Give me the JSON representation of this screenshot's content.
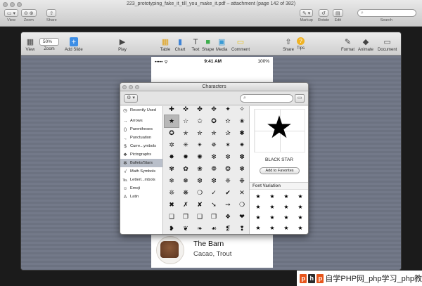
{
  "preview": {
    "title": "223_prototyping_fake_it_till_you_make_it.pdf – attachment (page 142 of 382)",
    "toolbar": [
      {
        "name": "view",
        "glyph": "▭ ▾",
        "label": "View"
      },
      {
        "name": "zoom",
        "glyph": "⊖ ⊕",
        "label": "Zoom"
      },
      {
        "name": "share",
        "glyph": "⇧",
        "label": "Share"
      },
      {
        "name": "markup",
        "glyph": "✎ ▾",
        "label": "Markup"
      },
      {
        "name": "rotate",
        "glyph": "↺",
        "label": "Rotate"
      },
      {
        "name": "edit",
        "glyph": "▤",
        "label": "Edit"
      }
    ],
    "search_label": "Search"
  },
  "keynote": {
    "zoom_value": "50%",
    "tools": [
      {
        "name": "view",
        "glyph": "▦",
        "label": "View"
      },
      {
        "name": "zoom",
        "glyph": "",
        "label": "Zoom"
      },
      {
        "name": "add-slide",
        "glyph": "+",
        "label": "Add Slide"
      },
      {
        "name": "play",
        "glyph": "▶",
        "label": "Play"
      },
      {
        "name": "table",
        "glyph": "▦",
        "label": "Table"
      },
      {
        "name": "chart",
        "glyph": "▮",
        "label": "Chart"
      },
      {
        "name": "text",
        "glyph": "T",
        "label": "Text"
      },
      {
        "name": "shape",
        "glyph": "■",
        "label": "Shape"
      },
      {
        "name": "media",
        "glyph": "▣",
        "label": "Media"
      },
      {
        "name": "comment",
        "glyph": "▭",
        "label": "Comment"
      },
      {
        "name": "share",
        "glyph": "⇧",
        "label": "Share"
      },
      {
        "name": "tips",
        "glyph": "?",
        "label": "Tips"
      },
      {
        "name": "format",
        "glyph": "✎",
        "label": "Format"
      },
      {
        "name": "animate",
        "glyph": "◆",
        "label": "Animate"
      },
      {
        "name": "document",
        "glyph": "▭",
        "label": "Document"
      }
    ],
    "phone": {
      "signal": "••••• ᯤ",
      "time": "9:41 AM",
      "battery": "100%",
      "restaurant_name": "The Barn",
      "restaurant_tags": "Cacao, Trout"
    }
  },
  "characters": {
    "title": "Characters",
    "search_placeholder": "",
    "categories": [
      {
        "glyph": "◷",
        "label": "Recently Used"
      },
      {
        "glyph": "→",
        "label": "Arrows"
      },
      {
        "glyph": "()",
        "label": "Parentheses"
      },
      {
        "glyph": ".,",
        "label": "Punctuation"
      },
      {
        "glyph": "$",
        "label": "Curre...ymbols"
      },
      {
        "glyph": "❖",
        "label": "Pictographs"
      },
      {
        "glyph": "✻",
        "label": "Bullets/Stars"
      },
      {
        "glyph": "√",
        "label": "Math Symbols"
      },
      {
        "glyph": "℡",
        "label": "Letterl...mbols"
      },
      {
        "glyph": "☺",
        "label": "Emoji"
      },
      {
        "glyph": "A",
        "label": "Latin"
      }
    ],
    "selected_category": "Bullets/Stars",
    "glyphs": [
      "✚",
      "✜",
      "✤",
      "✥",
      "✦",
      "✧",
      "★",
      "☆",
      "✩",
      "✪",
      "✫",
      "✬",
      "✪",
      "✭",
      "✮",
      "✯",
      "✰",
      "✱",
      "✲",
      "✳",
      "✴",
      "✵",
      "✶",
      "✷",
      "✸",
      "✹",
      "✺",
      "✻",
      "✼",
      "✽",
      "✾",
      "✿",
      "❀",
      "❁",
      "❂",
      "❃",
      "❄",
      "❅",
      "❆",
      "❇",
      "❈",
      "❉",
      "❊",
      "❋",
      "❍",
      "✓",
      "✔",
      "✕",
      "✖",
      "✗",
      "✘",
      "➘",
      "➙",
      "❍",
      "❏",
      "❐",
      "❑",
      "❒",
      "❖",
      "❤",
      "❥",
      "❦",
      "❧",
      "☙",
      "❡",
      "❢"
    ],
    "selected_char_name": "BLACK STAR",
    "selected_char": "★",
    "favorites_button": "Add to Favorites",
    "font_variation_label": "Font Variation",
    "variations": [
      "★",
      "★",
      "★",
      "★",
      "★",
      "★",
      "★",
      "★",
      "★",
      "★",
      "★",
      "★",
      "★",
      "★",
      "★",
      "★",
      "★",
      "★",
      "★",
      "★",
      "★",
      "★",
      "★",
      "★"
    ]
  },
  "watermark": {
    "text": "自学PHP网_php学习_php教"
  }
}
